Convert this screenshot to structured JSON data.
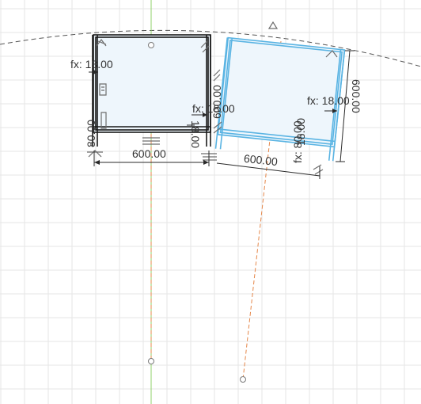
{
  "sketch": {
    "colors": {
      "grid": "#e6e6e6",
      "selected_edge": "#5ab4e3",
      "unselected_edge": "#1a1a1a",
      "axis_vertical": "#8fd06a",
      "axis_rotated": "#e5874a",
      "arc": "#555555"
    },
    "dimensions": {
      "left_width": "600.00",
      "right_width": "600.00",
      "left_thickness": "fx: 18.00",
      "left_bottom_height": "80.00",
      "mid_thickness_a": "fx: 18.00",
      "mid_thickness_b": "18.00",
      "mid_height": "600.00",
      "right_thickness": "fx: 18.00",
      "right_height": "600.00",
      "right_inner": "18.00",
      "right_bottom": "fx: 80.00"
    }
  }
}
